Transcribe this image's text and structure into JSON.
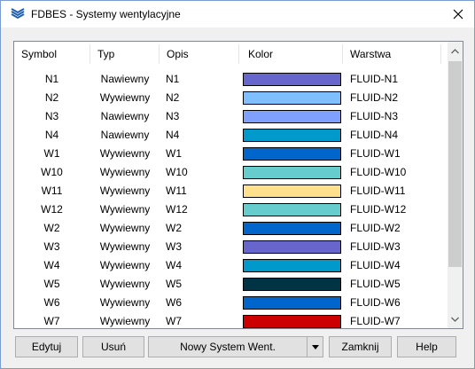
{
  "window": {
    "title": "FDBES - Systemy wentylacyjne"
  },
  "columns": [
    "Symbol",
    "Typ",
    "Opis",
    "Kolor",
    "Warstwa"
  ],
  "rows": [
    {
      "symbol": "N1",
      "typ": "Nawiewny",
      "opis": "N1",
      "color": "#6666cc",
      "warstwa": "FLUID-N1"
    },
    {
      "symbol": "N2",
      "typ": "Wywiewny",
      "opis": "N2",
      "color": "#80bfff",
      "warstwa": "FLUID-N2"
    },
    {
      "symbol": "N3",
      "typ": "Nawiewny",
      "opis": "N3",
      "color": "#80a0ff",
      "warstwa": "FLUID-N3"
    },
    {
      "symbol": "N4",
      "typ": "Nawiewny",
      "opis": "N4",
      "color": "#0099cc",
      "warstwa": "FLUID-N4"
    },
    {
      "symbol": "W1",
      "typ": "Wywiewny",
      "opis": "W1",
      "color": "#0066cc",
      "warstwa": "FLUID-W1"
    },
    {
      "symbol": "W10",
      "typ": "Wywiewny",
      "opis": "W10",
      "color": "#66cccc",
      "warstwa": "FLUID-W10"
    },
    {
      "symbol": "W11",
      "typ": "Wywiewny",
      "opis": "W11",
      "color": "#ffe08c",
      "warstwa": "FLUID-W11"
    },
    {
      "symbol": "W12",
      "typ": "Wywiewny",
      "opis": "W12",
      "color": "#66cccc",
      "warstwa": "FLUID-W12"
    },
    {
      "symbol": "W2",
      "typ": "Wywiewny",
      "opis": "W2",
      "color": "#0066cc",
      "warstwa": "FLUID-W2"
    },
    {
      "symbol": "W3",
      "typ": "Wywiewny",
      "opis": "W3",
      "color": "#6666cc",
      "warstwa": "FLUID-W3"
    },
    {
      "symbol": "W4",
      "typ": "Wywiewny",
      "opis": "W4",
      "color": "#0099cc",
      "warstwa": "FLUID-W4"
    },
    {
      "symbol": "W5",
      "typ": "Wywiewny",
      "opis": "W5",
      "color": "#003344",
      "warstwa": "FLUID-W5"
    },
    {
      "symbol": "W6",
      "typ": "Wywiewny",
      "opis": "W6",
      "color": "#0066cc",
      "warstwa": "FLUID-W6"
    },
    {
      "symbol": "W7",
      "typ": "Wywiewny",
      "opis": "W7",
      "color": "#cc0000",
      "warstwa": "FLUID-W7"
    }
  ],
  "buttons": {
    "edit": "Edytuj",
    "delete": "Usuń",
    "new_system": "Nowy System Went.",
    "close": "Zamknij",
    "help": "Help"
  },
  "icons": {
    "app": "fdbes-logo-icon",
    "close": "close-icon",
    "scroll_up": "chevron-up-icon",
    "scroll_down": "chevron-down-icon",
    "dropdown": "triangle-down-icon"
  }
}
